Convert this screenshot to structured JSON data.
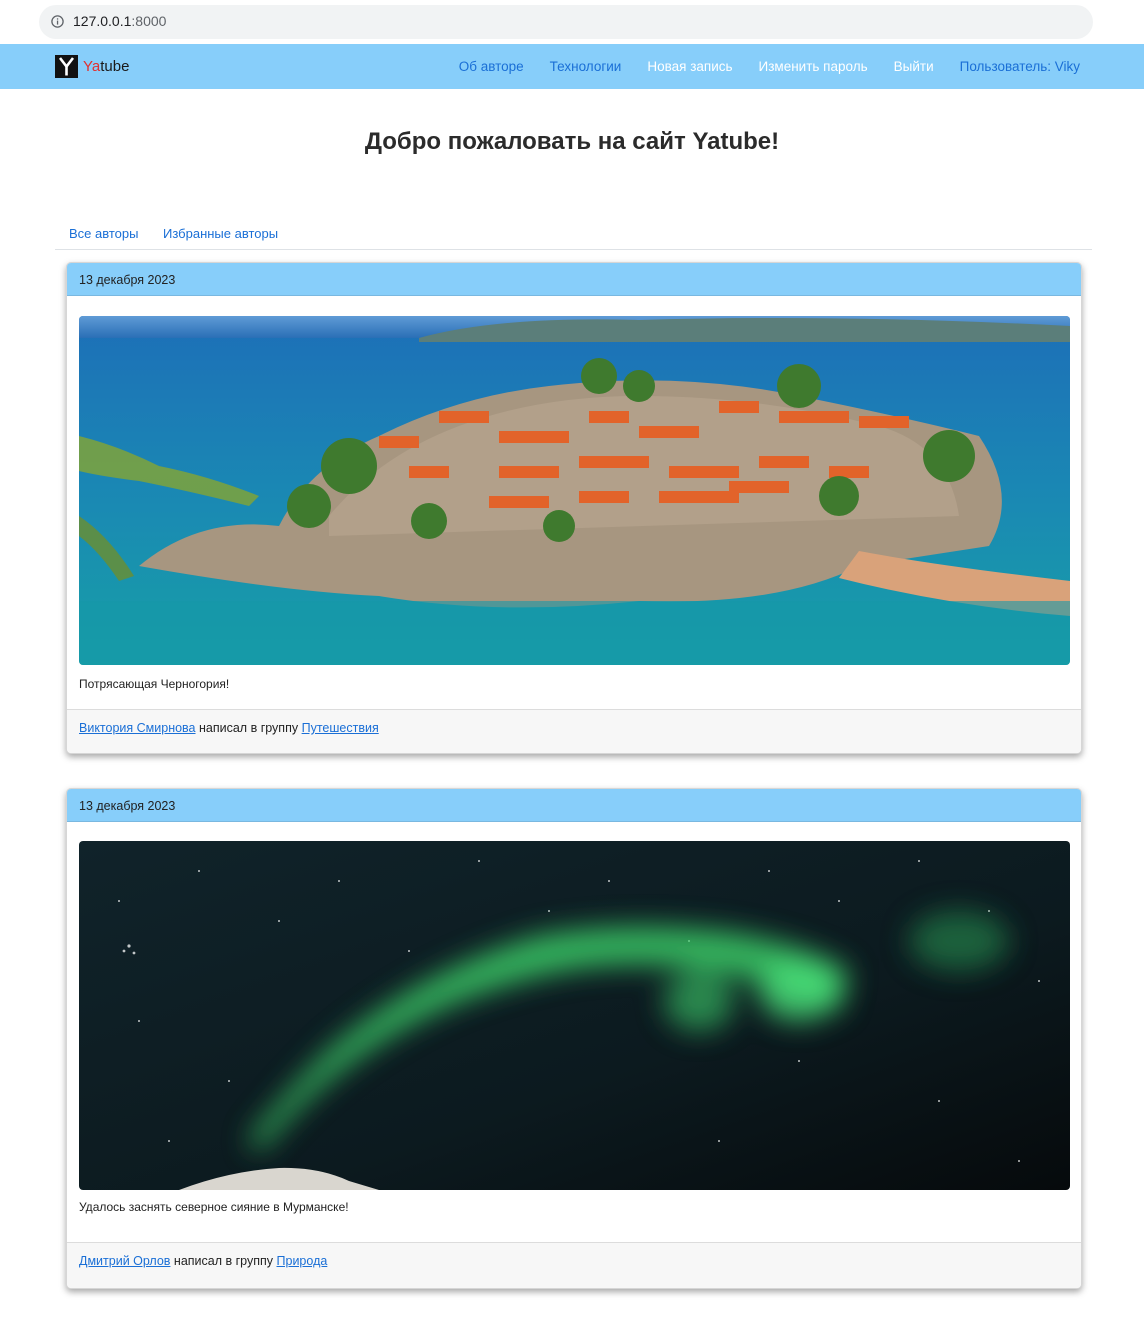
{
  "browser": {
    "url_host": "127.0.0.1",
    "url_port": ":8000"
  },
  "navbar": {
    "brand_prefix": "Ya",
    "brand_suffix": "tube",
    "links": [
      {
        "label": "Об авторе"
      },
      {
        "label": "Технологии"
      },
      {
        "label": "Новая запись"
      },
      {
        "label": "Изменить пароль"
      },
      {
        "label": "Выйти"
      },
      {
        "label": "Пользователь: Viky"
      }
    ]
  },
  "page": {
    "title": "Добро пожаловать на сайт Yatube!"
  },
  "tabs": [
    {
      "label": "Все авторы"
    },
    {
      "label": "Избранные авторы"
    }
  ],
  "posts": [
    {
      "date": "13 декабря 2023",
      "text": "Потрясающая Черногория!",
      "author": "Виктория Смирнова",
      "wrote_in_group": "написал в группу",
      "group": "Путешествия"
    },
    {
      "date": "13 декабря 2023",
      "text": "Удалось заснять северное сияние в Мурманске!",
      "author": "Дмитрий Орлов",
      "wrote_in_group": "написал в группу",
      "group": "Природа"
    }
  ],
  "colors": {
    "navbar_bg": "#87cefa",
    "link": "#1a6fd6"
  }
}
